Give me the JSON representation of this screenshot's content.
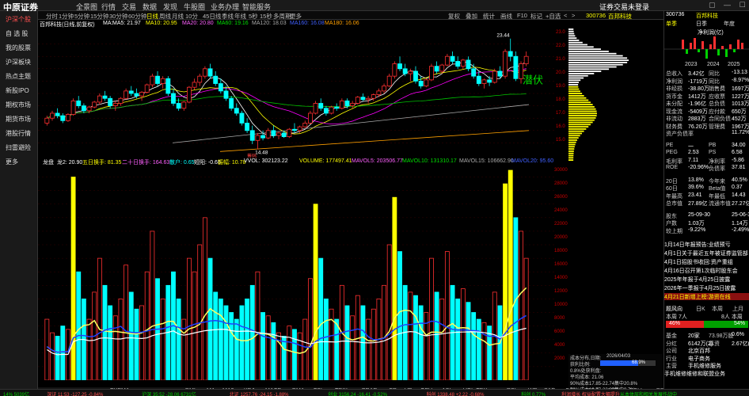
{
  "app": {
    "logo": "中原证券",
    "login": "证券交易未登录",
    "win_controls": "▢ — ☐ ✕"
  },
  "menu": [
    "全景图",
    "行情",
    "交易",
    "数据",
    "发现",
    "牛股圈",
    "业务办理",
    "智能服务"
  ],
  "leftnav": [
    "沪深个股",
    "自 选 股",
    "我的股票",
    "沪深板块",
    "热点主题",
    "新股IPO",
    "期权市场",
    "期货市场",
    "港股行情",
    "扫雷避险",
    "更多"
  ],
  "toolbar": {
    "periods": [
      "分时",
      "1分钟",
      "5分钟",
      "15分钟",
      "30分钟",
      "60分钟",
      "日线",
      "周线",
      "月线",
      "10分",
      "45日线",
      "季线",
      "年线",
      "5秒",
      "15秒",
      "多周期",
      "更多"
    ],
    "active_period": "日线",
    "right": [
      "复权",
      "叠加",
      "统计",
      "画线",
      "F10",
      "标记",
      "+自选",
      "<",
      ">"
    ]
  },
  "stock": {
    "code": "300736",
    "name": "百邦科技",
    "title": "百邦科技(日线,前复权)"
  },
  "ma": {
    "label": "MA:",
    "ma5": "MA5: 21.97",
    "ma10": "MA10: 20.95",
    "ma20": "MA20: 20.80",
    "ma60": "MA60: 19.16",
    "ma120": "MA120: 18.03",
    "ma160": "MA160: 16.08",
    "ma180": "MA180: 16.06"
  },
  "chart_labels": {
    "high": "23.44",
    "low": "14.48",
    "qianfu": "潜伏",
    "chip_marker": "筹码"
  },
  "price_axis": [
    "23.0",
    "22.0",
    "21.0",
    "20.0",
    "19.0",
    "18.0",
    "17.0",
    "16.0",
    "15.0"
  ],
  "sub_header": {
    "name": "龙盘",
    "v1": "龙2: 20.90",
    "v2": "五日换手: 81.35",
    "v3": "二十日换手: 164.63",
    "v4": "散户: 0.65",
    "v5": "短阳: -0.65",
    "v6": "振幅: 10.78",
    "vvol": "VVOL: 302123.22",
    "volume": "VOLUME: 177497.41",
    "mavol5": "MAVOL5: 203506.77",
    "mavol10": "MAVOL10: 131310.17",
    "mavol15": "MAVOL15: 106662.90",
    "mavol_x": "MAVOL20: 95.60"
  },
  "vol_axis": [
    "30000",
    "28000",
    "26000",
    "24000",
    "22000",
    "20000",
    "18000",
    "16000",
    "14000",
    "12000",
    "10000",
    "8000",
    "6000",
    "4000",
    "2000"
  ],
  "x_axis": {
    "left": "2025年",
    "mid1": "12",
    "right": "4"
  },
  "indicator_tabs": [
    "指标A",
    "窗口",
    "超赢",
    "三线",
    "EXPMA",
    "龙盘",
    "平均成本",
    "DMI",
    "MA",
    "MA2",
    "KDJ",
    "MACD",
    "DMA",
    "FSL",
    "TRIX",
    "BRAR",
    "CR",
    "VR",
    "OBV",
    "ASI",
    "VOL-TDX",
    "RSI",
    "WR",
    "SAR",
    "CCI",
    "ROC",
    "MTM",
    "BOLL",
    "PSY",
    "MCST",
    "龙线",
    "筹码",
    "模板",
    "日线"
  ],
  "cost": {
    "title": "成本分布,日期:",
    "date": "2026/04/03",
    "profit_label": "获利比例:",
    "profit": "68.9%",
    "profit_at": "0.8%处获利盘:",
    "avg_cost": "平均成本: 21.06",
    "c90": "90%成本17.85-22.74集中20.8%",
    "c70": "70%成本19.77-22.05集中9.7%"
  },
  "rp": {
    "code": "300736",
    "name": "百邦科技",
    "tabs": [
      "单季",
      "日季",
      "年度"
    ],
    "year_label": "净利润(亿)",
    "years": [
      "2023",
      "2024",
      "2025"
    ],
    "fin": [
      [
        "总收入",
        "3.42亿",
        "同比",
        "-13.13"
      ],
      [
        "净利润",
        "-1719万",
        "同比",
        "-8.97%"
      ],
      [
        "非经损",
        "-38.80万",
        "销售费",
        "1697万"
      ],
      [
        "货币金",
        "1412万",
        "应收票",
        "1227万"
      ],
      [
        "未分配",
        "-1.96亿",
        "总负债",
        "1013万"
      ],
      [
        "现金流",
        "-5409万",
        "应付款",
        "650万"
      ],
      [
        "非流动",
        "2883万",
        "合同负债",
        "452万"
      ],
      [
        "财务费",
        "76.20万",
        "管理费",
        "1967万"
      ],
      [
        "资产负债率",
        "",
        "",
        "11.72%"
      ]
    ],
    "val": [
      [
        "PE",
        "一",
        "PB",
        "34.00"
      ],
      [
        "PEG",
        "2.53",
        "PS",
        "6.58"
      ],
      [
        "毛利率",
        "7.11",
        "净利率",
        "-5.86"
      ],
      [
        "ROE",
        "-20.96%",
        "负债率",
        "37.81"
      ]
    ],
    "perf": [
      [
        "20日",
        "13.8%",
        "今年来",
        "40.5%"
      ],
      [
        "60日",
        "39.6%",
        "Beta值",
        "0.37"
      ],
      [
        "年最高",
        "23.41",
        "年最低",
        "14.43"
      ],
      [
        "总市值",
        "27.89亿",
        "流通市值",
        "27.27亿"
      ]
    ],
    "holders": [
      [
        "股东",
        "25-09-30",
        "",
        "25-06-30"
      ],
      [
        "户数",
        "1.03万",
        "",
        "1.14万"
      ],
      [
        "较上期",
        "-9.22%",
        "",
        "-2.49%"
      ]
    ],
    "news": [
      "1月14日年报预告:业绩预亏",
      "4月1日关于最近五年被证券监管部",
      "4月1日招股书收回:资产重组",
      "4月16日召开第1次临时股东会",
      "2025年年报于4月25日披露",
      "2026年一季报于4月25日披露",
      "4月21日新增上榜:游资在线"
    ],
    "hot": {
      "title": "题风向",
      "h1": "日K",
      "h2": "本周",
      "h3": "上月",
      "left": "本周 7人",
      "right": "8人 本周",
      "bull": "46%",
      "bear": "54%"
    },
    "extra": [
      [
        "基金",
        "20家",
        "73.98万股",
        "0.6%"
      ],
      [
        "分红",
        "6142万(2)",
        "募资",
        "2.67亿(4)"
      ],
      [
        "公司",
        "北京百邦",
        "",
        ""
      ],
      [
        "行业",
        "电子商务",
        "",
        ""
      ],
      [
        "主营",
        "手机维修服务",
        ""
      ]
    ],
    "product": "手机维修维修和联盟业务"
  },
  "status": [
    "14% 5039亿",
    "深证 11:53 -127.25 -0.84%",
    "沪深 35:52 -28.06 6731亿",
    "北证 1257.76 -24.15 -1.88%",
    "创业 3156.24 -16.41 -0.52%",
    "科创 1338.48 +2.22 -0.68%",
    "科创 0.77%",
    "利润增长 权益配置大幅提升",
    "从本体层和相关发展作战中"
  ],
  "colors": {
    "up": "#ff3030",
    "down": "#00ffff",
    "ma5": "#ffffff",
    "ma10": "#ffff00",
    "ma20": "#ff00ff",
    "ma60": "#00c000",
    "ma120": "#aaaaaa",
    "bg": "#000000"
  },
  "chart_data": {
    "type": "candlestick",
    "title": "百邦科技(日线,前复权)",
    "ylim": [
      14.0,
      24.0
    ],
    "high_label": 23.44,
    "low_label": 14.48,
    "ohlc": [
      [
        16.6,
        17.2,
        16.4,
        17.0
      ],
      [
        17.0,
        17.6,
        16.8,
        17.4
      ],
      [
        17.4,
        17.8,
        17.0,
        17.2
      ],
      [
        17.2,
        17.4,
        16.6,
        16.8
      ],
      [
        16.8,
        17.4,
        16.7,
        17.3
      ],
      [
        17.3,
        18.6,
        17.2,
        18.4
      ],
      [
        18.4,
        18.8,
        17.8,
        18.0
      ],
      [
        18.0,
        18.2,
        17.4,
        17.6
      ],
      [
        17.6,
        18.0,
        17.4,
        17.9
      ],
      [
        17.9,
        18.4,
        17.8,
        18.3
      ],
      [
        18.3,
        19.0,
        18.1,
        18.8
      ],
      [
        18.8,
        19.2,
        18.4,
        18.6
      ],
      [
        18.6,
        18.8,
        17.8,
        18.0
      ],
      [
        18.0,
        18.4,
        17.6,
        18.2
      ],
      [
        18.2,
        18.7,
        18.0,
        18.6
      ],
      [
        18.6,
        19.4,
        18.5,
        19.2
      ],
      [
        19.2,
        19.6,
        18.8,
        19.0
      ],
      [
        19.0,
        19.4,
        18.6,
        18.8
      ],
      [
        18.8,
        19.2,
        18.4,
        19.1
      ],
      [
        19.1,
        19.8,
        19.0,
        19.7
      ],
      [
        19.7,
        20.6,
        19.5,
        20.4
      ],
      [
        20.4,
        20.8,
        19.6,
        19.8
      ],
      [
        19.8,
        20.4,
        19.4,
        20.2
      ],
      [
        20.2,
        20.4,
        18.8,
        19.0
      ],
      [
        19.0,
        19.4,
        18.0,
        18.2
      ],
      [
        18.2,
        18.6,
        17.6,
        17.8
      ],
      [
        17.8,
        18.4,
        17.6,
        18.3
      ],
      [
        18.3,
        19.6,
        18.2,
        19.5
      ],
      [
        19.5,
        20.2,
        19.3,
        19.9
      ],
      [
        19.9,
        20.6,
        19.6,
        20.4
      ],
      [
        20.4,
        21.2,
        20.2,
        21.0
      ],
      [
        21.0,
        21.4,
        20.2,
        20.4
      ],
      [
        20.4,
        20.8,
        19.6,
        19.8
      ],
      [
        19.8,
        20.2,
        19.0,
        19.2
      ],
      [
        19.2,
        19.6,
        18.4,
        18.6
      ],
      [
        18.6,
        18.8,
        17.6,
        17.8
      ],
      [
        17.8,
        18.2,
        17.2,
        17.4
      ],
      [
        17.4,
        17.6,
        16.4,
        16.6
      ],
      [
        16.6,
        17.0,
        15.8,
        16.0
      ],
      [
        16.0,
        16.4,
        14.9,
        15.2
      ],
      [
        15.2,
        15.8,
        14.48,
        15.6
      ],
      [
        15.6,
        16.0,
        15.2,
        15.4
      ],
      [
        15.4,
        16.2,
        15.3,
        16.0
      ],
      [
        16.0,
        16.4,
        15.4,
        15.6
      ],
      [
        15.6,
        15.9,
        15.3,
        15.8
      ],
      [
        15.8,
        16.0,
        15.4,
        15.5
      ],
      [
        15.5,
        16.2,
        15.4,
        16.1
      ],
      [
        16.1,
        16.6,
        15.8,
        16.0
      ],
      [
        16.0,
        16.4,
        15.8,
        16.3
      ],
      [
        16.3,
        16.8,
        16.2,
        16.6
      ],
      [
        16.6,
        17.6,
        16.5,
        17.4
      ],
      [
        17.4,
        18.4,
        17.3,
        18.2
      ],
      [
        18.2,
        18.6,
        17.6,
        17.8
      ],
      [
        17.8,
        18.0,
        17.2,
        17.4
      ],
      [
        17.4,
        18.0,
        17.3,
        17.9
      ],
      [
        17.9,
        18.2,
        17.6,
        17.8
      ],
      [
        17.8,
        18.6,
        17.7,
        18.4
      ],
      [
        18.4,
        18.6,
        17.8,
        18.0
      ],
      [
        18.0,
        18.4,
        17.8,
        18.2
      ],
      [
        18.2,
        18.8,
        18.1,
        18.7
      ],
      [
        18.7,
        19.0,
        18.4,
        18.5
      ],
      [
        18.5,
        18.8,
        18.2,
        18.6
      ],
      [
        18.6,
        19.0,
        18.4,
        18.9
      ],
      [
        18.9,
        19.4,
        18.7,
        19.2
      ],
      [
        19.2,
        19.8,
        19.0,
        19.6
      ],
      [
        19.6,
        20.6,
        19.5,
        20.4
      ],
      [
        20.4,
        21.6,
        20.2,
        21.4
      ],
      [
        21.4,
        22.0,
        20.8,
        21.0
      ],
      [
        21.0,
        21.4,
        20.4,
        20.6
      ],
      [
        20.6,
        21.0,
        20.0,
        20.8
      ],
      [
        20.8,
        21.2,
        19.8,
        20.0
      ],
      [
        20.0,
        20.4,
        19.4,
        19.6
      ],
      [
        19.6,
        20.2,
        19.5,
        20.1
      ],
      [
        20.1,
        21.4,
        20.0,
        21.2
      ],
      [
        21.2,
        21.6,
        20.6,
        20.8
      ],
      [
        20.8,
        21.4,
        20.6,
        21.3
      ],
      [
        21.3,
        22.2,
        21.2,
        22.0
      ],
      [
        22.0,
        22.4,
        21.4,
        21.6
      ],
      [
        21.6,
        22.0,
        21.0,
        21.2
      ],
      [
        21.2,
        21.8,
        21.0,
        21.7
      ],
      [
        21.7,
        22.0,
        20.8,
        21.0
      ],
      [
        21.0,
        21.4,
        20.2,
        20.4
      ],
      [
        20.4,
        20.8,
        19.6,
        19.8
      ],
      [
        19.8,
        20.2,
        19.4,
        20.1
      ],
      [
        20.1,
        20.4,
        19.6,
        19.9
      ],
      [
        19.9,
        21.0,
        19.8,
        20.8
      ],
      [
        20.8,
        21.2,
        20.2,
        20.4
      ],
      [
        20.4,
        22.6,
        20.2,
        22.4
      ],
      [
        22.4,
        23.44,
        21.6,
        22.0
      ],
      [
        22.0,
        22.4,
        20.0,
        20.2
      ],
      [
        20.2,
        21.6,
        19.8,
        21.4
      ],
      [
        21.4,
        22.4,
        21.2,
        22.0
      ]
    ],
    "volume": [
      9000,
      7000,
      6500,
      8000,
      7500,
      30000,
      16000,
      12000,
      9000,
      13000,
      18000,
      14000,
      11000,
      9500,
      12000,
      17000,
      13000,
      10500,
      11000,
      16000,
      22000,
      15000,
      12000,
      14000,
      16000,
      12000,
      9000,
      18000,
      16000,
      20000,
      24000,
      18000,
      13000,
      12000,
      11000,
      10000,
      9000,
      11000,
      12000,
      14000,
      16000,
      10000,
      9500,
      8500,
      7000,
      6500,
      8000,
      7500,
      7000,
      9000,
      15000,
      26000,
      18000,
      12000,
      10500,
      9000,
      14000,
      11000,
      9500,
      12500,
      11000,
      9000,
      10500,
      12000,
      14000,
      20000,
      27000,
      19000,
      14000,
      13000,
      12500,
      11000,
      10000,
      18000,
      13000,
      12000,
      19000,
      14000,
      12000,
      13500,
      11500,
      10000,
      9000,
      8500,
      8000,
      13000,
      11000,
      29000,
      31000,
      24000,
      22000,
      18000
    ]
  }
}
